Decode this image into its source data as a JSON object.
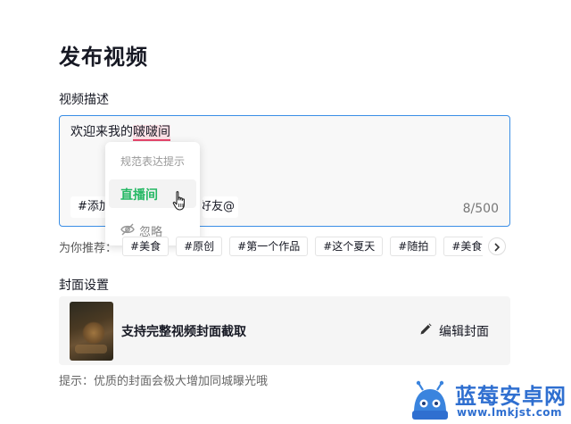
{
  "page": {
    "title": "发布视频"
  },
  "description": {
    "label": "视频描述",
    "text_before": "欢迎来我的",
    "text_flagged": "啵啵间",
    "counter": "8/500",
    "add_topic_chip": "#添加话题",
    "at_friend_chip": "@好友"
  },
  "suggestion_popup": {
    "hint": "规范表达提示",
    "suggested_word": "直播间",
    "ignore_label": "忽略",
    "accent_color": "#25b864"
  },
  "recommend": {
    "label": "为你推荐：",
    "tags": [
      "#美食",
      "#原创",
      "#第一个作品",
      "#这个夏天",
      "#随拍",
      "#美食vlog"
    ]
  },
  "cover": {
    "label": "封面设置",
    "description": "支持完整视频封面截取",
    "edit_label": "编辑封面"
  },
  "tip": "提示：优质的封面会极大增加同城曝光哦",
  "watermark": {
    "name": "蓝莓安卓网",
    "url": "www.lmkjst.com"
  }
}
